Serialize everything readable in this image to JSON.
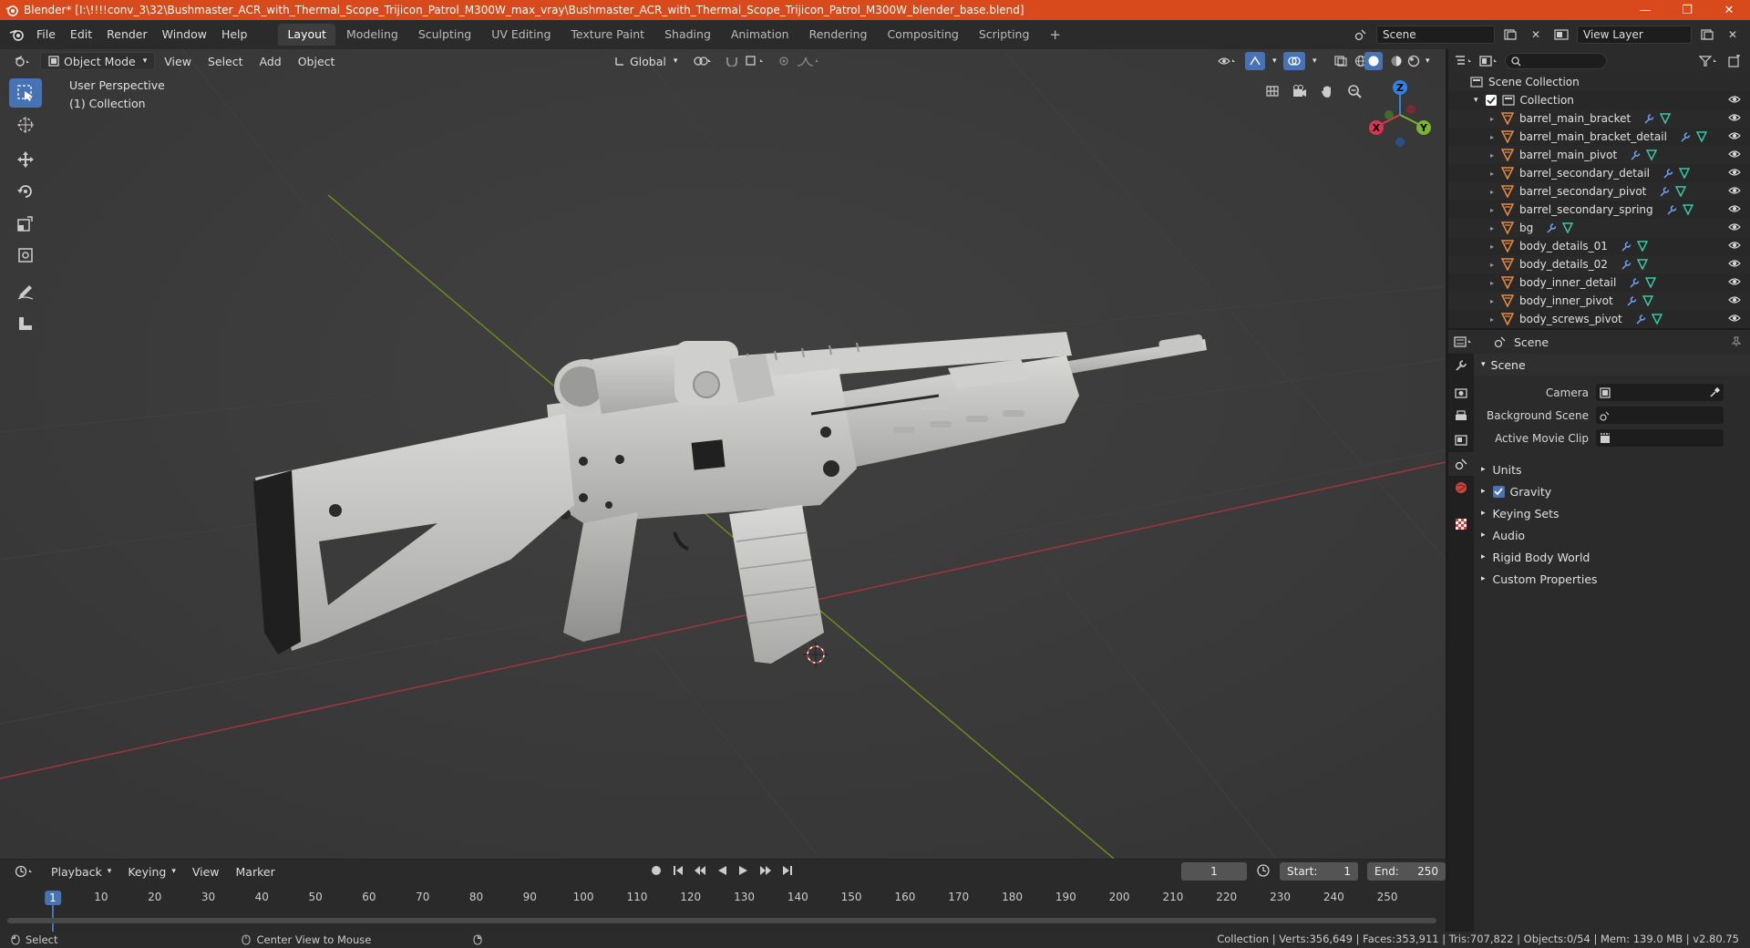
{
  "window": {
    "title": "Blender* [I:\\!!!!conv_3\\32\\Bushmaster_ACR_with_Thermal_Scope_Trijicon_Patrol_M300W_max_vray\\Bushmaster_ACR_with_Thermal_Scope_Trijicon_Patrol_M300W_blender_base.blend]",
    "controls": [
      "—",
      "❐",
      "✕"
    ]
  },
  "menu": [
    "File",
    "Edit",
    "Render",
    "Window",
    "Help"
  ],
  "workspaces": [
    "Layout",
    "Modeling",
    "Sculpting",
    "UV Editing",
    "Texture Paint",
    "Shading",
    "Animation",
    "Rendering",
    "Compositing",
    "Scripting"
  ],
  "active_workspace": "Layout",
  "scene_selector": "Scene",
  "view_layer": "View Layer",
  "viewport": {
    "mode": "Object Mode",
    "menus": [
      "View",
      "Select",
      "Add",
      "Object"
    ],
    "transform_orientation": "Global",
    "info_line1": "User Perspective",
    "info_line2": "(1) Collection",
    "gizmo_axes": [
      "X",
      "Y",
      "Z"
    ]
  },
  "outliner": {
    "root": "Scene Collection",
    "collection": "Collection",
    "objects": [
      "barrel_main_bracket",
      "barrel_main_bracket_detail",
      "barrel_main_pivot",
      "barrel_secondary_detail",
      "barrel_secondary_pivot",
      "barrel_secondary_spring",
      "bg",
      "body_details_01",
      "body_details_02",
      "body_inner_detail",
      "body_inner_pivot",
      "body_screws_pivot"
    ]
  },
  "properties": {
    "header": "Scene",
    "panel": "Scene",
    "rows": [
      {
        "label": "Camera"
      },
      {
        "label": "Background Scene"
      },
      {
        "label": "Active Movie Clip"
      }
    ],
    "subpanels": [
      "Units",
      "Gravity",
      "Keying Sets",
      "Audio",
      "Rigid Body World",
      "Custom Properties"
    ]
  },
  "timeline": {
    "menus": [
      "Playback",
      "Keying",
      "View",
      "Marker"
    ],
    "current_frame": "1",
    "start_label": "Start:",
    "start": "1",
    "end_label": "End:",
    "end": "250",
    "ticks": [
      "1",
      "10",
      "20",
      "30",
      "40",
      "50",
      "60",
      "70",
      "80",
      "90",
      "100",
      "110",
      "120",
      "130",
      "140",
      "150",
      "160",
      "170",
      "180",
      "190",
      "200",
      "210",
      "220",
      "230",
      "240",
      "250"
    ]
  },
  "statusbar": {
    "select": "Select",
    "center_view": "Center View to Mouse",
    "stats": "Collection | Verts:356,649 | Faces:353,911 | Tris:707,822 | Objects:0/54 | Mem: 139.0 MB | v2.80.75"
  },
  "colors": {
    "titlebar": "#d84a1b",
    "accent": "#4772b3",
    "object_icon": "#e8893a",
    "mesh_icon": "#3fc4a6",
    "x_axis": "#d8374f",
    "y_axis": "#7ab52c",
    "z_axis": "#2f84e3"
  }
}
